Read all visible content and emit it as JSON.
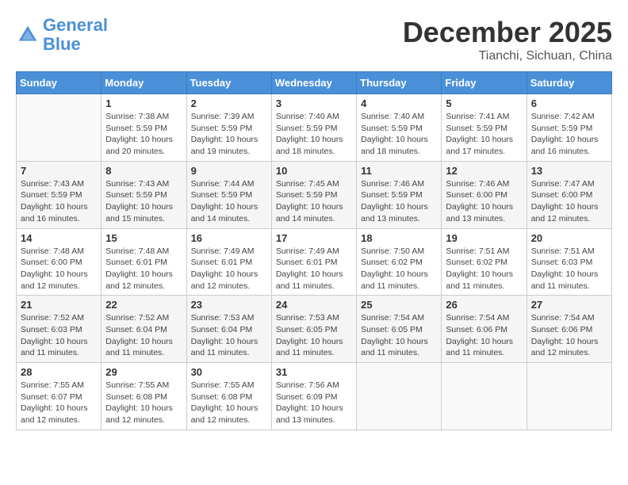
{
  "header": {
    "logo_line1": "General",
    "logo_line2": "Blue",
    "month_title": "December 2025",
    "location": "Tianchi, Sichuan, China"
  },
  "weekdays": [
    "Sunday",
    "Monday",
    "Tuesday",
    "Wednesday",
    "Thursday",
    "Friday",
    "Saturday"
  ],
  "weeks": [
    [
      {
        "day": "",
        "info": ""
      },
      {
        "day": "1",
        "info": "Sunrise: 7:38 AM\nSunset: 5:59 PM\nDaylight: 10 hours and 20 minutes."
      },
      {
        "day": "2",
        "info": "Sunrise: 7:39 AM\nSunset: 5:59 PM\nDaylight: 10 hours and 19 minutes."
      },
      {
        "day": "3",
        "info": "Sunrise: 7:40 AM\nSunset: 5:59 PM\nDaylight: 10 hours and 18 minutes."
      },
      {
        "day": "4",
        "info": "Sunrise: 7:40 AM\nSunset: 5:59 PM\nDaylight: 10 hours and 18 minutes."
      },
      {
        "day": "5",
        "info": "Sunrise: 7:41 AM\nSunset: 5:59 PM\nDaylight: 10 hours and 17 minutes."
      },
      {
        "day": "6",
        "info": "Sunrise: 7:42 AM\nSunset: 5:59 PM\nDaylight: 10 hours and 16 minutes."
      }
    ],
    [
      {
        "day": "7",
        "info": "Sunrise: 7:43 AM\nSunset: 5:59 PM\nDaylight: 10 hours and 16 minutes."
      },
      {
        "day": "8",
        "info": "Sunrise: 7:43 AM\nSunset: 5:59 PM\nDaylight: 10 hours and 15 minutes."
      },
      {
        "day": "9",
        "info": "Sunrise: 7:44 AM\nSunset: 5:59 PM\nDaylight: 10 hours and 14 minutes."
      },
      {
        "day": "10",
        "info": "Sunrise: 7:45 AM\nSunset: 5:59 PM\nDaylight: 10 hours and 14 minutes."
      },
      {
        "day": "11",
        "info": "Sunrise: 7:46 AM\nSunset: 5:59 PM\nDaylight: 10 hours and 13 minutes."
      },
      {
        "day": "12",
        "info": "Sunrise: 7:46 AM\nSunset: 6:00 PM\nDaylight: 10 hours and 13 minutes."
      },
      {
        "day": "13",
        "info": "Sunrise: 7:47 AM\nSunset: 6:00 PM\nDaylight: 10 hours and 12 minutes."
      }
    ],
    [
      {
        "day": "14",
        "info": "Sunrise: 7:48 AM\nSunset: 6:00 PM\nDaylight: 10 hours and 12 minutes."
      },
      {
        "day": "15",
        "info": "Sunrise: 7:48 AM\nSunset: 6:01 PM\nDaylight: 10 hours and 12 minutes."
      },
      {
        "day": "16",
        "info": "Sunrise: 7:49 AM\nSunset: 6:01 PM\nDaylight: 10 hours and 12 minutes."
      },
      {
        "day": "17",
        "info": "Sunrise: 7:49 AM\nSunset: 6:01 PM\nDaylight: 10 hours and 11 minutes."
      },
      {
        "day": "18",
        "info": "Sunrise: 7:50 AM\nSunset: 6:02 PM\nDaylight: 10 hours and 11 minutes."
      },
      {
        "day": "19",
        "info": "Sunrise: 7:51 AM\nSunset: 6:02 PM\nDaylight: 10 hours and 11 minutes."
      },
      {
        "day": "20",
        "info": "Sunrise: 7:51 AM\nSunset: 6:03 PM\nDaylight: 10 hours and 11 minutes."
      }
    ],
    [
      {
        "day": "21",
        "info": "Sunrise: 7:52 AM\nSunset: 6:03 PM\nDaylight: 10 hours and 11 minutes."
      },
      {
        "day": "22",
        "info": "Sunrise: 7:52 AM\nSunset: 6:04 PM\nDaylight: 10 hours and 11 minutes."
      },
      {
        "day": "23",
        "info": "Sunrise: 7:53 AM\nSunset: 6:04 PM\nDaylight: 10 hours and 11 minutes."
      },
      {
        "day": "24",
        "info": "Sunrise: 7:53 AM\nSunset: 6:05 PM\nDaylight: 10 hours and 11 minutes."
      },
      {
        "day": "25",
        "info": "Sunrise: 7:54 AM\nSunset: 6:05 PM\nDaylight: 10 hours and 11 minutes."
      },
      {
        "day": "26",
        "info": "Sunrise: 7:54 AM\nSunset: 6:06 PM\nDaylight: 10 hours and 11 minutes."
      },
      {
        "day": "27",
        "info": "Sunrise: 7:54 AM\nSunset: 6:06 PM\nDaylight: 10 hours and 12 minutes."
      }
    ],
    [
      {
        "day": "28",
        "info": "Sunrise: 7:55 AM\nSunset: 6:07 PM\nDaylight: 10 hours and 12 minutes."
      },
      {
        "day": "29",
        "info": "Sunrise: 7:55 AM\nSunset: 6:08 PM\nDaylight: 10 hours and 12 minutes."
      },
      {
        "day": "30",
        "info": "Sunrise: 7:55 AM\nSunset: 6:08 PM\nDaylight: 10 hours and 12 minutes."
      },
      {
        "day": "31",
        "info": "Sunrise: 7:56 AM\nSunset: 6:09 PM\nDaylight: 10 hours and 13 minutes."
      },
      {
        "day": "",
        "info": ""
      },
      {
        "day": "",
        "info": ""
      },
      {
        "day": "",
        "info": ""
      }
    ]
  ]
}
